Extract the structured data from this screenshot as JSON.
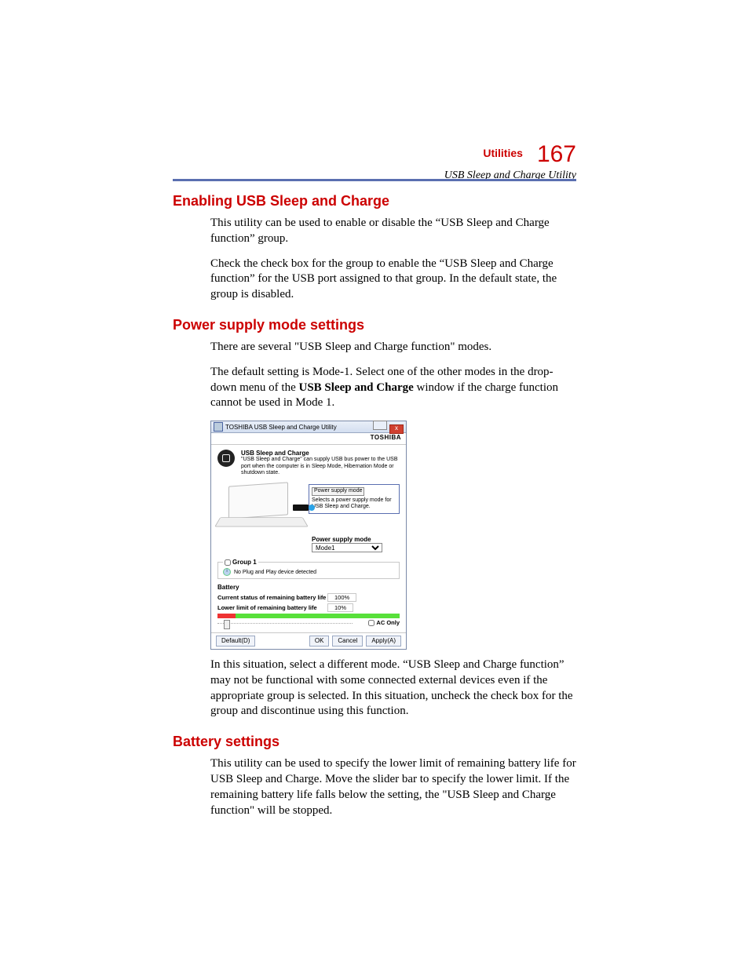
{
  "header": {
    "chapter": "Utilities",
    "page_number": "167",
    "section_italic": "USB Sleep and Charge Utility"
  },
  "sections": {
    "enable": {
      "title": "Enabling USB Sleep and Charge",
      "p1": "This utility can be used to enable or disable the “USB Sleep and Charge function” group.",
      "p2": "Check the check box for the group to enable the “USB Sleep and Charge function” for the USB port assigned to that group. In the default state, the group is disabled."
    },
    "power": {
      "title": "Power supply mode settings",
      "p1": "There are several \"USB Sleep and Charge function\" modes.",
      "p2a": "The default setting is Mode-1. Select one of the other modes in the drop-down menu of the ",
      "p2b_bold": "USB Sleep and Charge",
      "p2c": " window if the charge function cannot be used in Mode 1.",
      "p3": "In this situation, select a different mode. “USB Sleep and Charge function” may not be functional with some connected external devices even if the appropriate group is selected. In this situation, uncheck the check box for the group and discontinue using this function."
    },
    "battery": {
      "title": "Battery settings",
      "p1": "This utility can be used to specify the lower limit of remaining battery life for USB Sleep and Charge. Move the slider bar to specify the lower limit. If the remaining battery life falls below the setting, the \"USB Sleep and Charge function\" will be stopped."
    }
  },
  "dialog": {
    "title": "TOSHIBA USB Sleep and Charge Utility",
    "brand": "TOSHIBA",
    "header_title": "USB Sleep and Charge",
    "header_desc": "\"USB Sleep and Charge\" can supply USB bus power to the USB port when the computer is in Sleep Mode, Hibernation Mode or shutdown state.",
    "info_box_title": "Power supply mode",
    "info_box_desc": "Selects a power supply mode for USB Sleep and Charge.",
    "mode_label": "Power supply mode",
    "mode_value": "Mode1",
    "group_legend": "Group 1",
    "group_status": "No Plug and Play device detected",
    "battery_heading": "Battery",
    "current_label": "Current status of remaining battery life",
    "current_value": "100%",
    "lower_label": "Lower limit of remaining battery life",
    "lower_value": "10%",
    "ac_only": "AC Only",
    "btn_default": "Default(D)",
    "btn_ok": "OK",
    "btn_cancel": "Cancel",
    "btn_apply": "Apply(A)"
  }
}
